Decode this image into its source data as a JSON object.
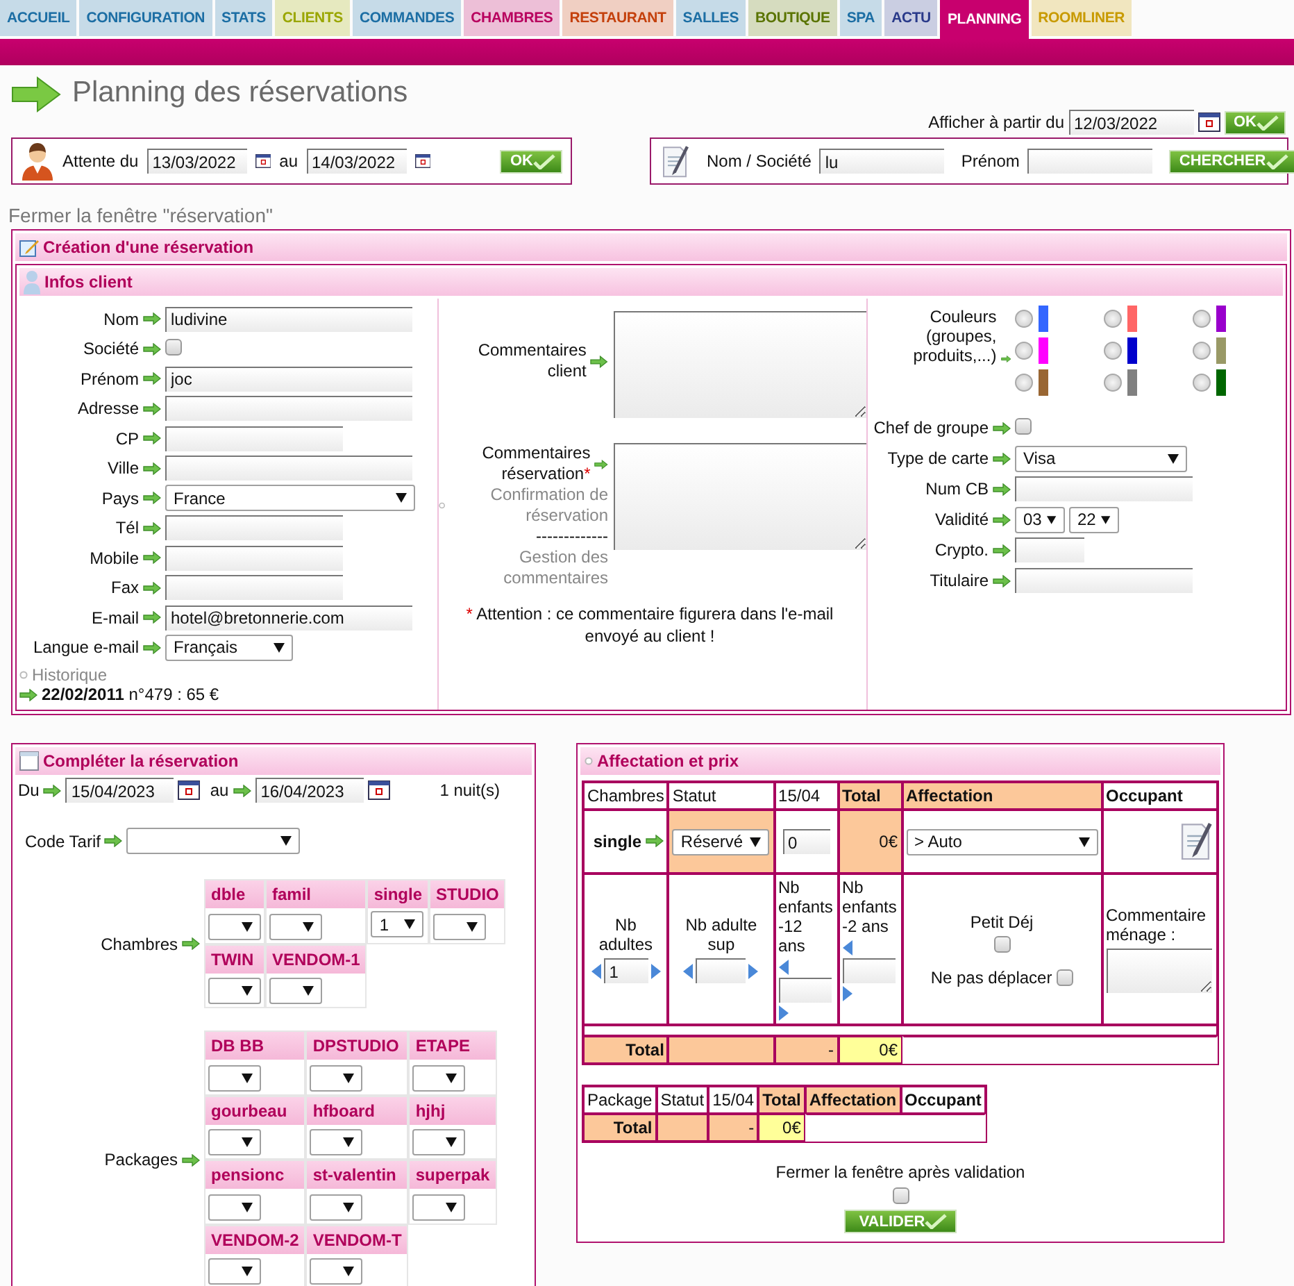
{
  "tabs": [
    {
      "label": "ACCUEIL",
      "color": "#1c6ea4",
      "selected": false
    },
    {
      "label": "CONFIGURATION",
      "color": "#1c6ea4",
      "selected": false
    },
    {
      "label": "STATS",
      "color": "#1c6ea4",
      "selected": false
    },
    {
      "label": "CLIENTS",
      "color": "#9aa600",
      "selected": false
    },
    {
      "label": "COMMANDES",
      "color": "#1c6ea4",
      "selected": false
    },
    {
      "label": "CHAMBRES",
      "color": "#b8005e",
      "selected": false
    },
    {
      "label": "RESTAURANT",
      "color": "#c4400c",
      "selected": false
    },
    {
      "label": "SALLES",
      "color": "#1c6ea4",
      "selected": false
    },
    {
      "label": "BOUTIQUE",
      "color": "#5a7400",
      "selected": false
    },
    {
      "label": "SPA",
      "color": "#1c6ea4",
      "selected": false
    },
    {
      "label": "ACTU",
      "color": "#2a3a8a",
      "selected": false
    },
    {
      "label": "PLANNING",
      "color": "#c8006e",
      "selected": true
    },
    {
      "label": "ROOMLINER",
      "color": "#c89a00",
      "selected": false
    }
  ],
  "header": {
    "title": "Planning des réservations",
    "show_from_label": "Afficher à partir du",
    "show_from": "12/03/2022",
    "ok": "OK"
  },
  "waiting": {
    "label": "Attente du",
    "from": "13/03/2022",
    "to_label": "au",
    "to": "14/03/2022",
    "ok": "OK"
  },
  "search": {
    "name_label": "Nom / Société",
    "name": "lu",
    "firstname_label": "Prénom",
    "button": "CHERCHER"
  },
  "close_link": "Fermer la fenêtre \"réservation\"",
  "reservation": {
    "title": "Création d'une réservation",
    "client": {
      "title": "Infos client",
      "fields": [
        {
          "label": "Nom",
          "kind": "long",
          "value": "ludivine"
        },
        {
          "label": "Société",
          "kind": "check",
          "checked": false
        },
        {
          "label": "Prénom",
          "kind": "long",
          "value": "joc"
        },
        {
          "label": "Adresse",
          "kind": "long"
        },
        {
          "label": "CP",
          "kind": "short"
        },
        {
          "label": "Ville",
          "kind": "long"
        },
        {
          "label": "Pays",
          "kind": "select",
          "value": "France"
        },
        {
          "label": "Tél",
          "kind": "short"
        },
        {
          "label": "Mobile",
          "kind": "short"
        },
        {
          "label": "Fax",
          "kind": "short"
        },
        {
          "label": "E-mail",
          "kind": "long",
          "value": "hotel@bretonnerie.com"
        },
        {
          "label": "Langue e-mail",
          "kind": "small_select",
          "value": "Français"
        }
      ],
      "history": {
        "label": "Historique",
        "date": "22/02/2011",
        "text": "n°479 : 65 €"
      },
      "comments": [
        {
          "label": "Commentaires client"
        },
        {
          "label": "Commentaires réservation",
          "mark": "*",
          "link": "Confirmation de réservation",
          "separator": "-------------",
          "extra": "Gestion des commentaires"
        }
      ],
      "note_mark": "*",
      "note": "Attention : ce commentaire figurera dans l'e-mail envoyé au client !",
      "colors_label": "Couleurs (groupes, produits,...)",
      "colors": [
        {
          "color": "#3366ff",
          "selected": false
        },
        {
          "color": "#ff6666",
          "selected": false
        },
        {
          "color": "#9900cc",
          "selected": false
        },
        {
          "color": "#ff00ff",
          "selected": false
        },
        {
          "color": "#0000cc",
          "selected": false
        },
        {
          "color": "#999966",
          "selected": false
        },
        {
          "color": "#996633",
          "selected": false
        },
        {
          "color": "#808080",
          "selected": false
        },
        {
          "color": "#006600",
          "selected": false
        }
      ],
      "right_fields": [
        {
          "label": "Chef de groupe",
          "kind": "check",
          "checked": false
        },
        {
          "label": "Type de carte",
          "kind": "select",
          "value": "Visa"
        },
        {
          "label": "Num CB",
          "kind": "long"
        },
        {
          "label": "Validité",
          "kind": "pair",
          "values": [
            "03",
            "22"
          ]
        },
        {
          "label": "Crypto.",
          "kind": "short"
        },
        {
          "label": "Titulaire",
          "kind": "long"
        }
      ]
    }
  },
  "complete": {
    "title": "Compléter la réservation",
    "from_label": "Du",
    "from": "15/04/2023",
    "to_label": "au",
    "to": "16/04/2023",
    "nights": "1 nuit(s)",
    "tariff_label": "Code Tarif",
    "rooms_label": "Chambres",
    "rooms": [
      {
        "name": "dble"
      },
      {
        "name": "famil"
      },
      {
        "name": "single",
        "value": "1"
      },
      {
        "name": "STUDIO"
      },
      {
        "name": "TWIN"
      },
      {
        "name": "VENDOM-1"
      }
    ],
    "packages_label": "Packages",
    "packages": [
      {
        "name": "DB BB"
      },
      {
        "name": "DPSTUDIO"
      },
      {
        "name": "ETAPE"
      },
      {
        "name": "gourbeau"
      },
      {
        "name": "hfboard"
      },
      {
        "name": "hjhj"
      },
      {
        "name": "pensionc"
      },
      {
        "name": "st-valentin"
      },
      {
        "name": "superpak"
      },
      {
        "name": "VENDOM-2"
      },
      {
        "name": "VENDOM-T"
      }
    ]
  },
  "affectation": {
    "title": "Affectation et prix",
    "columns": [
      {
        "label": "Chambres",
        "kind": "plain"
      },
      {
        "label": "Statut",
        "kind": "plain"
      },
      {
        "label": "15/04",
        "kind": "plain"
      },
      {
        "label": "Total",
        "kind": "accent"
      },
      {
        "label": "Affectation",
        "kind": "accent"
      },
      {
        "label": "Occupant",
        "kind": "bold"
      }
    ],
    "row": {
      "room": "single",
      "status": "Réservé",
      "price": "0",
      "total": "0€",
      "assignment": "> Auto"
    },
    "details": {
      "adults_label": "Nb adultes",
      "adults": "1",
      "extra_label": "Nb adulte sup",
      "kids12_label": "Nb enfants -12 ans",
      "kids2_label": "Nb enfants -2 ans",
      "breakfast_label": "Petit Déj",
      "breakfast": false,
      "no_move_label": "Ne pas déplacer",
      "no_move": false,
      "cleaning_label": "Commentaire ménage :"
    },
    "total": {
      "label": "Total",
      "dash": "-",
      "amount": "0€"
    },
    "package_columns": [
      {
        "label": "Package",
        "kind": "plain"
      },
      {
        "label": "Statut",
        "kind": "plain"
      },
      {
        "label": "15/04",
        "kind": "plain"
      },
      {
        "label": "Total",
        "kind": "accent"
      },
      {
        "label": "Affectation",
        "kind": "accent"
      },
      {
        "label": "Occupant",
        "kind": "bold"
      }
    ],
    "package_total": {
      "label": "Total",
      "dash": "-",
      "amount": "0€"
    },
    "close_after_label": "Fermer la fenêtre après validation",
    "close_after": false,
    "validate": "VALIDER"
  }
}
